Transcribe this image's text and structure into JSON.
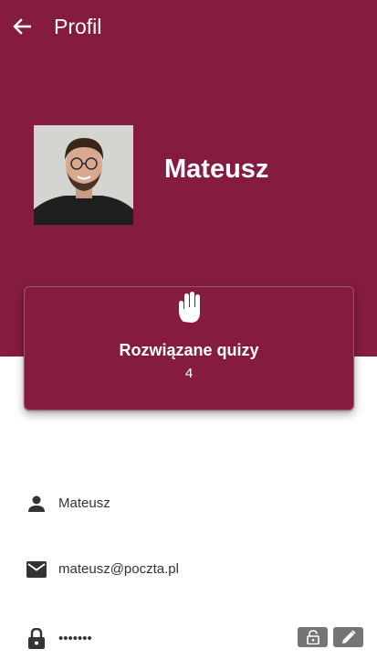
{
  "app": {
    "title": "Profil",
    "accent": "#851c3f"
  },
  "topbar": {
    "back_icon": "arrow-back-icon"
  },
  "profile": {
    "name": "Mateusz",
    "avatar_icon": "person-photo"
  },
  "stats_card": {
    "icon": "hand-icon",
    "label": "Rozwiązane quizy",
    "value": "4"
  },
  "details": {
    "username": {
      "icon": "person-icon",
      "value": "Mateusz"
    },
    "email": {
      "icon": "mail-icon",
      "value": "mateusz@poczta.pl"
    },
    "password": {
      "icon": "lock-icon",
      "value": "•••••••",
      "actions": [
        "unlock-icon",
        "edit-icon"
      ]
    }
  }
}
